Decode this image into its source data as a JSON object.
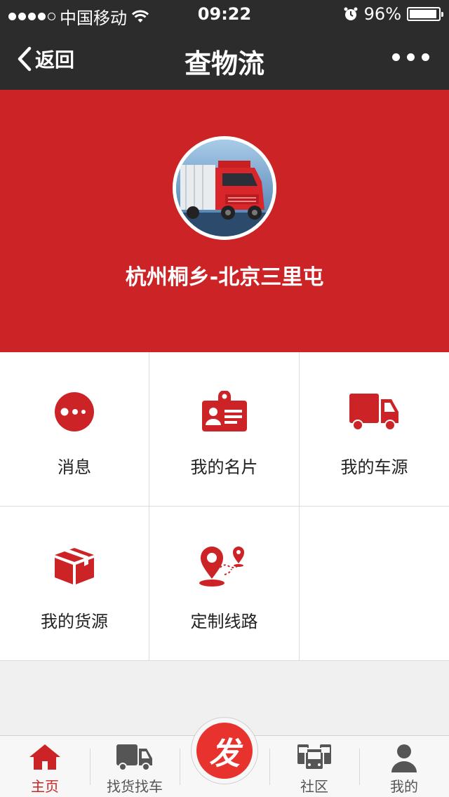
{
  "status_bar": {
    "carrier": "中国移动",
    "time": "09:22",
    "battery": "96%",
    "battery_level": 0.96,
    "icons": [
      "signal-dots-icon",
      "wifi-icon",
      "alarm-icon",
      "battery-icon"
    ]
  },
  "nav": {
    "back_label": "返回",
    "title": "查物流",
    "more_icon": "more-dots-icon"
  },
  "profile": {
    "route": "杭州桐乡-北京三里屯",
    "avatar_icon": "truck-photo-avatar"
  },
  "grid": {
    "items": [
      {
        "label": "消息",
        "icon": "message-bubble-icon"
      },
      {
        "label": "我的名片",
        "icon": "business-card-icon"
      },
      {
        "label": "我的车源",
        "icon": "truck-icon"
      },
      {
        "label": "我的货源",
        "icon": "package-box-icon"
      },
      {
        "label": "定制线路",
        "icon": "route-pin-icon"
      }
    ]
  },
  "tabbar": {
    "items": [
      {
        "label": "主页",
        "icon": "home-icon",
        "active": true
      },
      {
        "label": "找货找车",
        "icon": "truck-icon"
      },
      {
        "label": "社区",
        "icon": "community-buses-icon"
      },
      {
        "label": "我的",
        "icon": "person-icon"
      }
    ],
    "publish_label": "发"
  },
  "colors": {
    "brand_red": "#cc2426",
    "dark_bar": "#2c2c2c",
    "tab_gray": "#555555"
  }
}
